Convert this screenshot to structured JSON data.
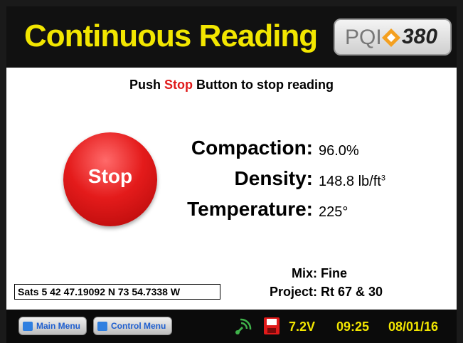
{
  "header": {
    "title": "Continuous Reading",
    "logo_prefix": "PQI",
    "logo_number": "380"
  },
  "instruction": {
    "before": "Push ",
    "stop_word": "Stop",
    "after": " Button to stop reading"
  },
  "stop_button": {
    "label": "Stop"
  },
  "readings": {
    "compaction": {
      "label": "Compaction:",
      "value": "96.0%"
    },
    "density": {
      "label": "Density:",
      "value": "148.8 lb/ft",
      "unit_sup": "3"
    },
    "temperature": {
      "label": "Temperature:",
      "value": "225°"
    }
  },
  "mix": {
    "label": "Mix:",
    "value": "Fine"
  },
  "project": {
    "label": "Project:",
    "value": "Rt 67 & 30"
  },
  "gps": {
    "text": "Sats 5 42 47.19092 N 73 54.7338 W"
  },
  "footer": {
    "main_menu_label": "Main Menu",
    "control_menu_label": "Control Menu",
    "voltage": "7.2V",
    "time": "09:25",
    "date": "08/01/16"
  },
  "colors": {
    "title_yellow": "#f2e600",
    "stop_red": "#e01a1a",
    "background": "#ffffff",
    "bar_black": "#111111"
  }
}
